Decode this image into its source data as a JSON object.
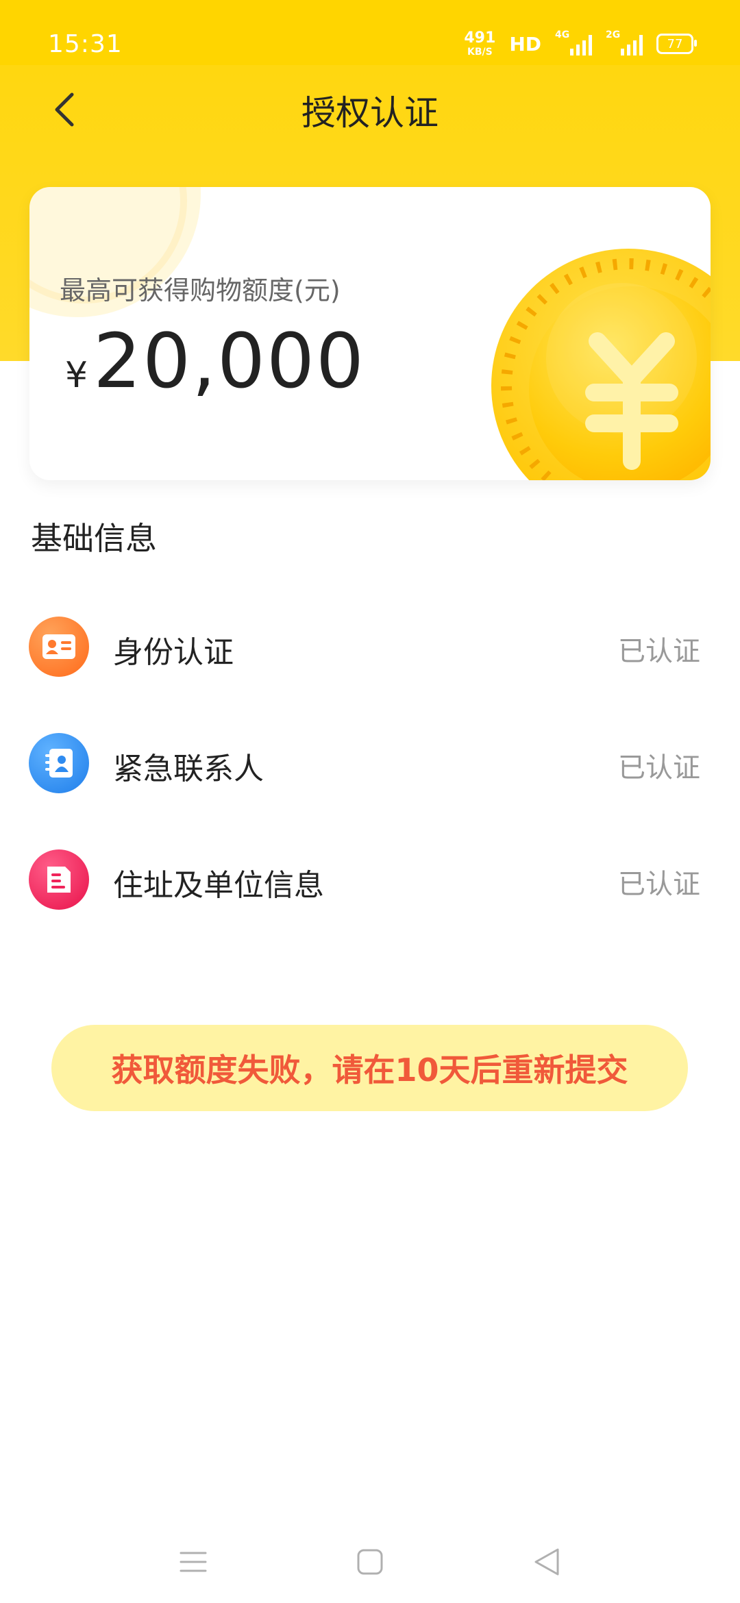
{
  "status_bar": {
    "time": "15:31",
    "net_speed_value": "491",
    "net_speed_unit": "KB/S",
    "hd_label": "HD",
    "signal1_tag": "4G",
    "signal2_tag": "2G",
    "battery": "77"
  },
  "header": {
    "title": "授权认证",
    "back_icon": "chevron-left-icon"
  },
  "credit_card": {
    "label": "最高可获得购物额度(元)",
    "currency_symbol": "¥",
    "amount": "20,000",
    "coin_icon": "yen-coin-icon"
  },
  "section": {
    "title": "基础信息"
  },
  "info_items": [
    {
      "label": "身份认证",
      "status": "已认证",
      "icon": "id-card-icon",
      "color": "#FF7A2E"
    },
    {
      "label": "紧急联系人",
      "status": "已认证",
      "icon": "contact-book-icon",
      "color": "#2E8BF0"
    },
    {
      "label": "住址及单位信息",
      "status": "已认证",
      "icon": "document-icon",
      "color": "#F0245A"
    }
  ],
  "notice": {
    "text": "获取额度失败，请在10天后重新提交"
  },
  "colors": {
    "brand_yellow": "#FFD500",
    "notice_bg": "#FFF3A3",
    "notice_text": "#F0593A",
    "status_gray": "#999999"
  },
  "system_nav": {
    "menu_icon": "menu-icon",
    "home_icon": "home-square-icon",
    "back_icon": "back-triangle-icon"
  }
}
